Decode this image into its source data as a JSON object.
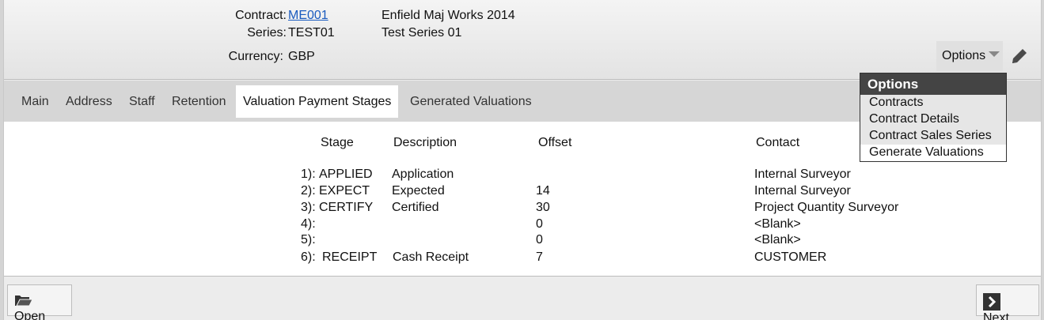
{
  "header": {
    "contract_label": "Contract:",
    "contract_value": "ME001",
    "contract_name": "Enfield Maj Works 2014",
    "series_label": "Series:",
    "series_value": "TEST01",
    "series_name": "Test Series 01",
    "currency_label": "Currency:",
    "currency_value": "GBP",
    "options_label": "Options"
  },
  "tabs": [
    {
      "label": "Main"
    },
    {
      "label": "Address"
    },
    {
      "label": "Staff"
    },
    {
      "label": "Retention"
    },
    {
      "label": "Valuation Payment Stages",
      "active": true
    },
    {
      "label": "Generated Valuations"
    }
  ],
  "table": {
    "columns": [
      "Stage",
      "Description",
      "Offset",
      "Contact"
    ],
    "rows": [
      {
        "num": "1):",
        "stage": "APPLIED",
        "description": "Application",
        "offset": "",
        "contact": "Internal Surveyor"
      },
      {
        "num": "2):",
        "stage": "EXPECT",
        "description": "Expected",
        "offset": "14",
        "contact": "Internal Surveyor"
      },
      {
        "num": "3):",
        "stage": "CERTIFY",
        "description": "Certified",
        "offset": "30",
        "contact": "Project Quantity Surveyor"
      },
      {
        "num": "4):",
        "stage": "",
        "description": "",
        "offset": "0",
        "contact": "<Blank>"
      },
      {
        "num": "5):",
        "stage": "",
        "description": "",
        "offset": "0",
        "contact": "<Blank>"
      },
      {
        "num": "6):",
        "stage": "RECEIPT",
        "description": "Cash Receipt",
        "offset": "7",
        "contact": "CUSTOMER"
      }
    ]
  },
  "dropdown": {
    "title": "Options",
    "items": [
      "Contracts",
      "Contract Details",
      "Contract Sales Series",
      "Generate Valuations"
    ]
  },
  "footer": {
    "open_label": "Open",
    "next_label": "Next"
  },
  "icons": {
    "open": "folder-open-icon",
    "next": "chevron-right-icon",
    "edit": "pencil-icon",
    "options_caret": "caret-down-icon"
  }
}
